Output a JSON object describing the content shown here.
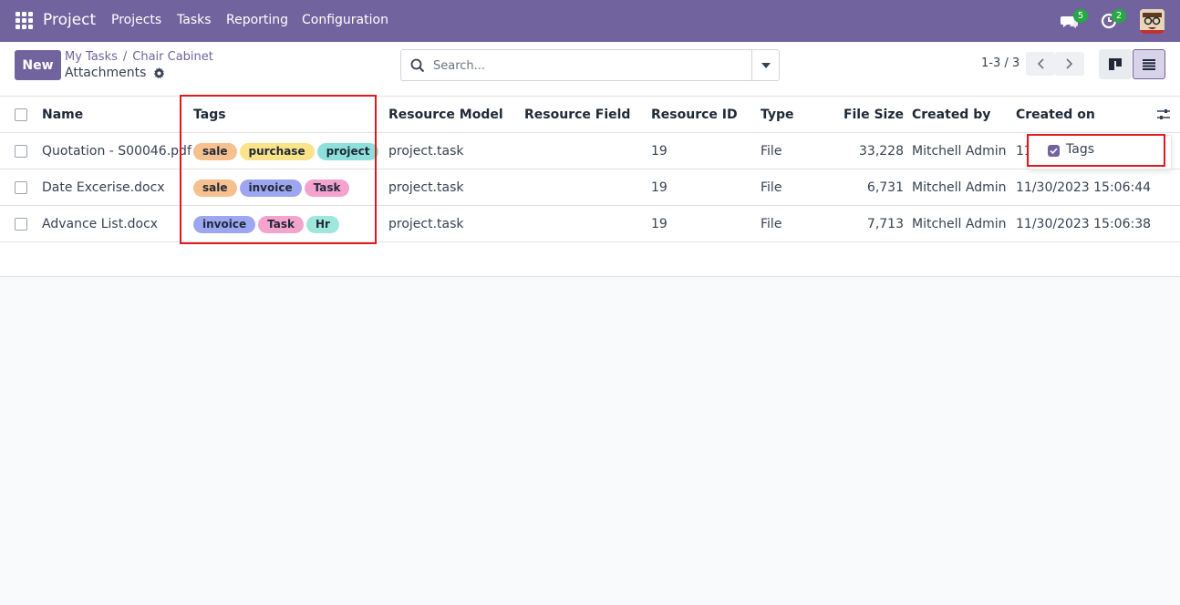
{
  "navbar": {
    "brand": "Project",
    "menu": [
      "Projects",
      "Tasks",
      "Reporting",
      "Configuration"
    ],
    "chat_count": "5",
    "activity_count": "2"
  },
  "control": {
    "new_label": "New",
    "breadcrumb": [
      "My Tasks",
      "Chair Cabinet"
    ],
    "breadcrumb_sep": "/",
    "title": "Attachments",
    "search_placeholder": "Search...",
    "pager": "1-3 / 3"
  },
  "table": {
    "columns": [
      "Name",
      "Tags",
      "Resource Model",
      "Resource Field",
      "Resource ID",
      "Type",
      "File Size",
      "Created by",
      "Created on"
    ],
    "rows": [
      {
        "name": "Quotation - S00046.pdf",
        "tags": [
          "sale",
          "purchase",
          "project"
        ],
        "resource_model": "project.task",
        "resource_field": "",
        "resource_id": "19",
        "type": "File",
        "file_size": "33,228",
        "created_by": "Mitchell Admin",
        "created_on": "11"
      },
      {
        "name": "Date Excerise.docx",
        "tags": [
          "sale",
          "invoice",
          "Task"
        ],
        "resource_model": "project.task",
        "resource_field": "",
        "resource_id": "19",
        "type": "File",
        "file_size": "6,731",
        "created_by": "Mitchell Admin",
        "created_on": "11/30/2023 15:06:44"
      },
      {
        "name": "Advance List.docx",
        "tags": [
          "invoice",
          "Task",
          "Hr"
        ],
        "resource_model": "project.task",
        "resource_field": "",
        "resource_id": "19",
        "type": "File",
        "file_size": "7,713",
        "created_by": "Mitchell Admin",
        "created_on": "11/30/2023 15:06:38"
      }
    ]
  },
  "tag_colors": {
    "sale": "#f6c08f",
    "purchase": "#fbe38a",
    "project": "#8ee1db",
    "invoice": "#9da7f1",
    "Task": "#f4a3cf",
    "Hr": "#9fe6dc"
  },
  "optional_columns": {
    "tags_label": "Tags"
  },
  "colors": {
    "brand": "#71639e",
    "highlight": "#e0191f",
    "badge": "#28a745"
  }
}
